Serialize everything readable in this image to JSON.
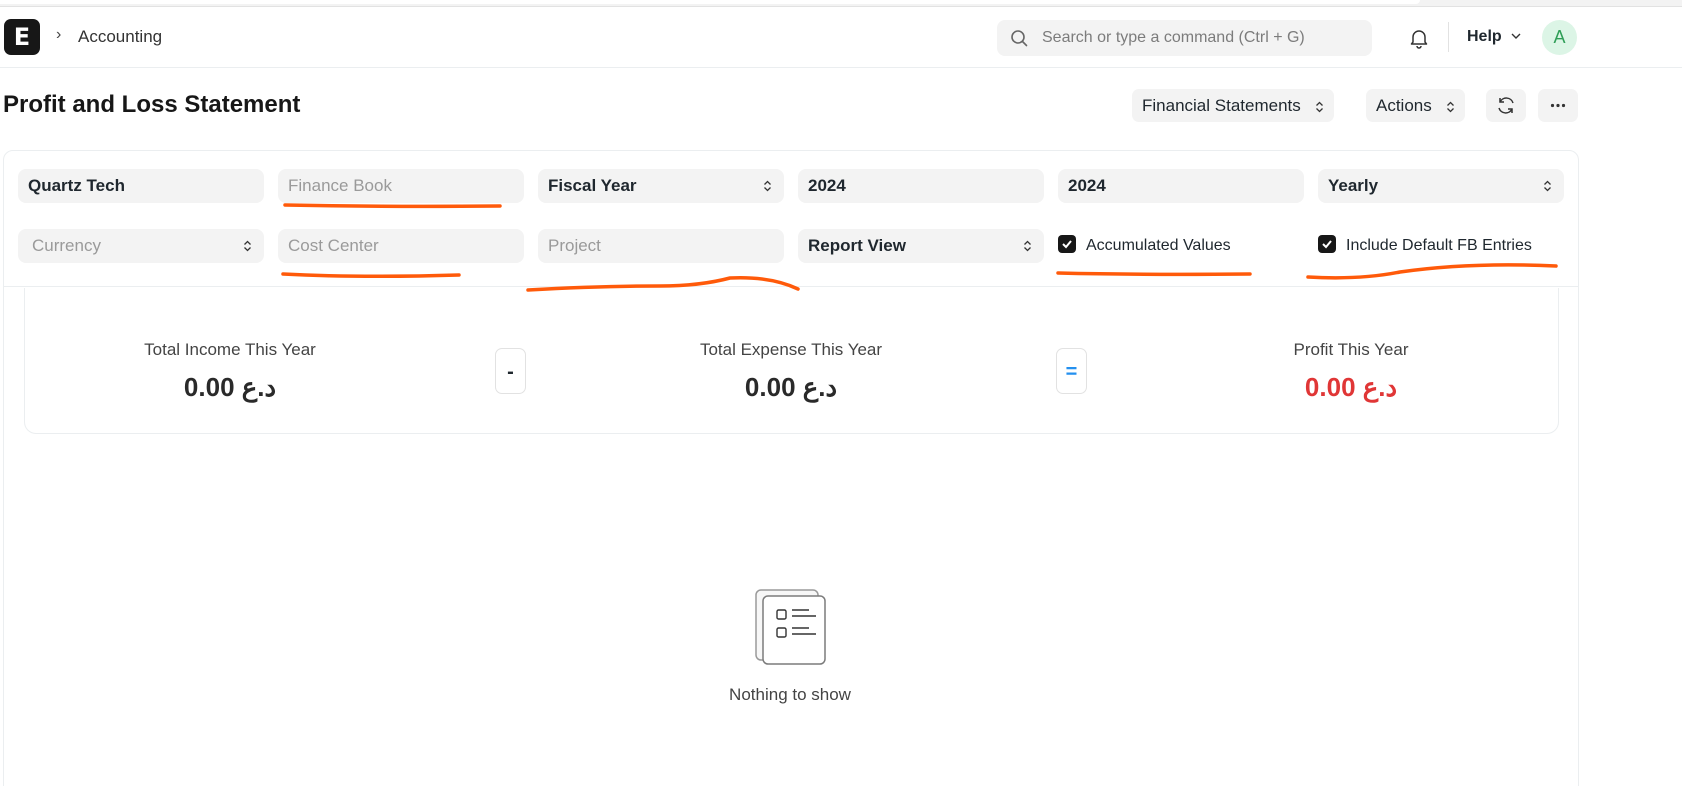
{
  "navbar": {
    "logo_letter": "E",
    "breadcrumb": "Accounting",
    "search_placeholder": "Search or type a command (Ctrl + G)",
    "help_label": "Help",
    "avatar_letter": "A"
  },
  "page": {
    "title": "Profit and Loss Statement",
    "financial_statements_label": "Financial Statements",
    "actions_label": "Actions"
  },
  "filters": {
    "company": "Quartz Tech",
    "finance_book_placeholder": "Finance Book",
    "period_type": "Fiscal Year",
    "from_year": "2024",
    "to_year": "2024",
    "periodicity": "Yearly",
    "currency_placeholder": "Currency",
    "cost_center_placeholder": "Cost Center",
    "project_placeholder": "Project",
    "view": "Report View",
    "accumulated_values_label": "Accumulated Values",
    "accumulated_values_checked": true,
    "include_default_fb_label": "Include Default FB Entries",
    "include_default_fb_checked": true
  },
  "summary": {
    "income_label": "Total Income This Year",
    "income_value": "0.00 د.ع",
    "minus_op": "-",
    "expense_label": "Total Expense This Year",
    "expense_value": "0.00 د.ع",
    "equals_op": "=",
    "profit_label": "Profit This Year",
    "profit_value": "0.00 د.ع"
  },
  "empty_state": {
    "message": "Nothing to show"
  },
  "colors": {
    "annotation": "#ff5a0a",
    "negative": "#e03636",
    "equals_blue": "#2490ef"
  }
}
